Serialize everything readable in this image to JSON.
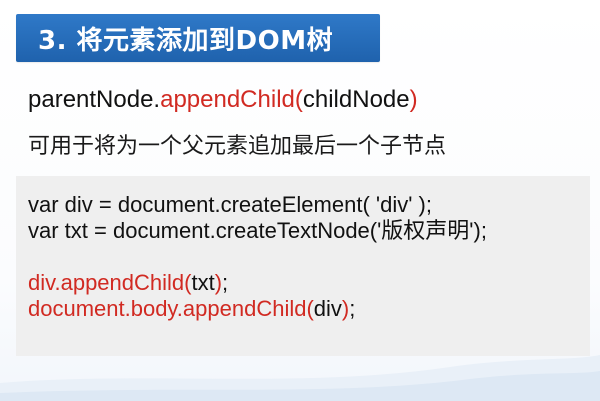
{
  "title": "3. 将元素添加到DOM树",
  "syntax": {
    "obj": "parentNode.",
    "method": "appendChild",
    "open": "(",
    "param": "childNode",
    "close": ")"
  },
  "description": "可用于将为一个父元素追加最后一个子节点",
  "code": {
    "line1": "var div = document.createElement( 'div' );",
    "line2": "var txt = document.createTextNode('版权声明');",
    "line3": {
      "red": "div.appendChild(",
      "arg": "txt",
      "red_close": ")",
      "tail": ";"
    },
    "line4": {
      "red": "document.body.appendChild(",
      "arg": "div",
      "red_close": ")",
      "tail": ";"
    }
  },
  "colors": {
    "title_bg": "#2a72c1",
    "accent_red": "#d12a22",
    "code_bg": "#efefef"
  }
}
